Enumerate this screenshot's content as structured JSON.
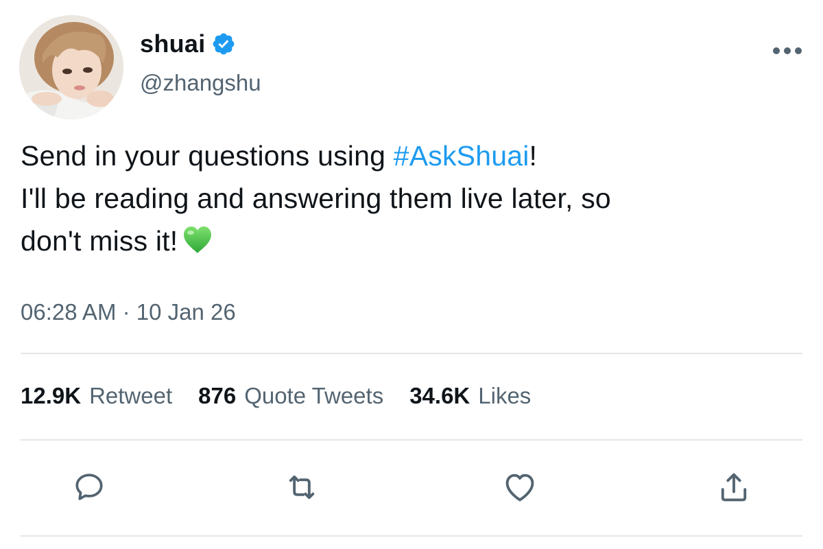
{
  "author": {
    "display_name": "shuai",
    "handle": "@zhangshu",
    "verified": true,
    "avatar_icon": "profile-photo"
  },
  "tweet": {
    "text_before_hashtag": "Send in your questions using ",
    "hashtag": "#AskShuai",
    "text_after_hashtag": "!",
    "line2": "I'll be reading and answering them live later, so",
    "line3": "don't miss it!",
    "emoji": "green-heart"
  },
  "timestamp": "06:28 AM · 10 Jan 26",
  "stats": {
    "retweets": {
      "count": "12.9K",
      "label": "Retweet"
    },
    "quote_tweets": {
      "count": "876",
      "label": "Quote Tweets"
    },
    "likes": {
      "count": "34.6K",
      "label": "Likes"
    }
  },
  "actions": {
    "reply_icon": "speech-bubble-icon",
    "retweet_icon": "retweet-arrows-icon",
    "like_icon": "heart-outline-icon",
    "share_icon": "share-upload-icon"
  },
  "colors": {
    "accent": "#1d9bf0",
    "text_primary": "#0f1419",
    "text_secondary": "#536471",
    "divider": "#e3e6e8",
    "verified": "#1d9bf0",
    "emoji_heart": "#3fbf3f"
  }
}
